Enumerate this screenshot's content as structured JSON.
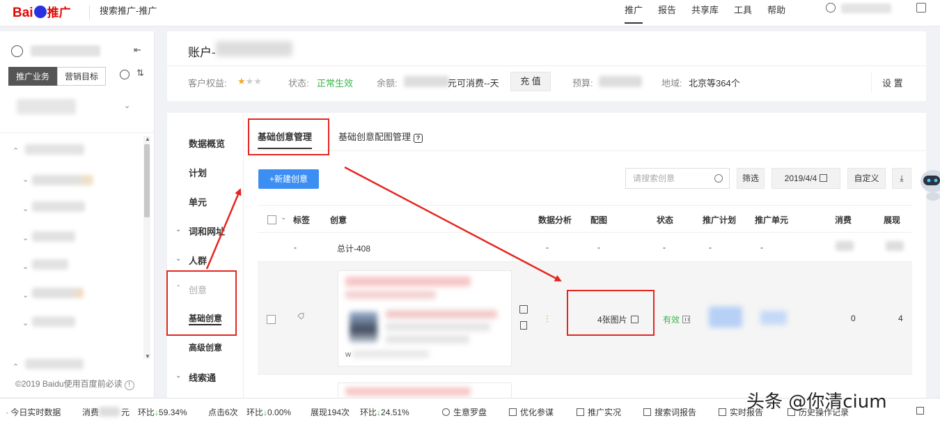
{
  "topbar": {
    "logo_text_bai": "Bai",
    "logo_text_tuiguang": "推广",
    "app_name": "搜索推广-推广",
    "nav": [
      "推广",
      "报告",
      "共享库",
      "工具",
      "帮助"
    ],
    "active_nav": "推广"
  },
  "sidebar": {
    "tabs": [
      "推广业务",
      "营销目标"
    ],
    "footer": "©2019 Baidu使用百度前必读",
    "footer_info": "!"
  },
  "account": {
    "title_prefix": "账户-",
    "rights_label": "客户权益:",
    "status_label": "状态:",
    "status_value": "正常生效",
    "balance_label": "余额:",
    "balance_suffix": "元",
    "consumable": "可消费--天",
    "charge_button": "充 值",
    "budget_label": "预算:",
    "region_label": "地域:",
    "region_value": "北京等364个",
    "settings": "设 置",
    "stars": "★",
    "star_rating": 1,
    "star_total": 3
  },
  "subnav": {
    "items": [
      "数据概览",
      "计划",
      "单元",
      "词和网址",
      "人群",
      "创意",
      "基础创意",
      "高级创意",
      "线索通"
    ],
    "active": "基础创意"
  },
  "tabs": {
    "items": [
      "基础创意管理",
      "基础创意配图管理"
    ],
    "active": "基础创意管理",
    "help_icon": "?"
  },
  "toolbar": {
    "new_button": "+新建创意",
    "search_placeholder": "请搜索创意",
    "filter": "筛选",
    "date": "2019/4/4",
    "customize": "自定义",
    "download": "⤓"
  },
  "table": {
    "headers": [
      "标签",
      "创意",
      "数据分析",
      "配图",
      "状态",
      "推广计划",
      "推广单元",
      "消费",
      "展现"
    ],
    "total": {
      "label": "-",
      "creative": "总计-408",
      "analysis": "-",
      "image": "-",
      "status": "-",
      "plan": "-",
      "unit": "-"
    },
    "row": {
      "image_count": "4张图片",
      "status": "有效",
      "spend": "0",
      "impressions": "4",
      "card_footer_char": "w"
    }
  },
  "bottombar": {
    "realtime": "今日实时数据",
    "spend_label": "消费",
    "spend_suffix": "元",
    "spend_ratio_label": "环比",
    "spend_ratio": "59.34%",
    "clicks": "点击6次",
    "clicks_ratio_label": "环比",
    "clicks_ratio": "0.00%",
    "impressions": "展现194次",
    "impressions_ratio_label": "环比",
    "impressions_ratio": "24.51%",
    "down_arrow": "↓",
    "links": [
      "生意罗盘",
      "优化参谋",
      "推广实况",
      "搜索词报告",
      "实时报告",
      "历史操作记录"
    ]
  },
  "watermark": "头条 @你清cium",
  "colors": {
    "accent_blue": "#3c8ef3",
    "status_green": "#3ab54a",
    "annotation_red": "#e5251f",
    "brand_red": "#e10602"
  }
}
